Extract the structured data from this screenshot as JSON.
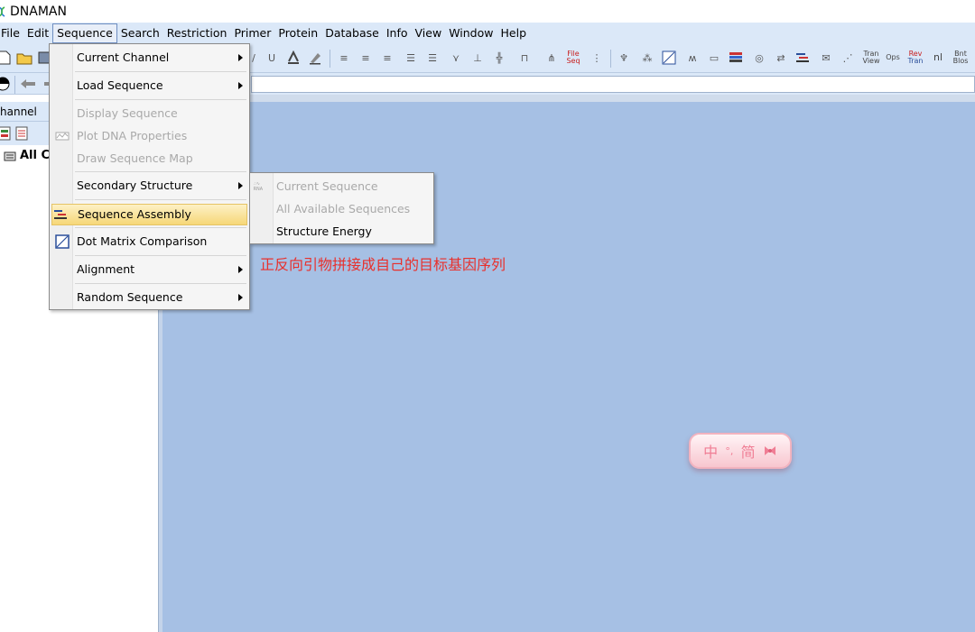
{
  "window": {
    "title": "DNAMAN"
  },
  "menubar": {
    "items": [
      "File",
      "Edit",
      "Sequence",
      "Search",
      "Restriction",
      "Primer",
      "Protein",
      "Database",
      "Info",
      "View",
      "Window",
      "Help"
    ],
    "open_item": "Sequence"
  },
  "toolbar": {
    "file_seq": "File Seq",
    "rev_tran_line1": "Rev",
    "rev_tran_line2": "Tran",
    "tran_view_line1": "Tran",
    "tran_view_line2": "View",
    "ops": "Ops",
    "orf_line1": "Bnt",
    "orf_line2": "Blos",
    "nt": "nl"
  },
  "channel_panel": {
    "header": "hannel",
    "tree_root": "All C"
  },
  "sequence_menu": {
    "items": [
      {
        "label": "Current Channel",
        "enabled": true,
        "submenu": true
      },
      {
        "label": "Load Sequence",
        "enabled": true,
        "submenu": true
      },
      {
        "label": "Display Sequence",
        "enabled": false,
        "submenu": false
      },
      {
        "label": "Plot DNA Properties",
        "enabled": false,
        "submenu": false
      },
      {
        "label": "Draw Sequence Map",
        "enabled": false,
        "submenu": false
      },
      {
        "label": "Secondary Structure",
        "enabled": true,
        "submenu": true
      },
      {
        "label": "Sequence Assembly",
        "enabled": true,
        "submenu": false,
        "highlighted": true
      },
      {
        "label": "Dot Matrix Comparison",
        "enabled": true,
        "submenu": false
      },
      {
        "label": "Alignment",
        "enabled": true,
        "submenu": true
      },
      {
        "label": "Random Sequence",
        "enabled": true,
        "submenu": true
      }
    ]
  },
  "secondary_structure_submenu": {
    "items": [
      {
        "label": "Current Sequence",
        "enabled": false
      },
      {
        "label": "All Available Sequences",
        "enabled": false
      },
      {
        "label": "Structure Energy",
        "enabled": true
      }
    ]
  },
  "annotation": {
    "text": "正反向引物拼接成自己的目标基因序列"
  },
  "ime": {
    "mode": "中",
    "punct": "°,",
    "simplified": "简"
  }
}
